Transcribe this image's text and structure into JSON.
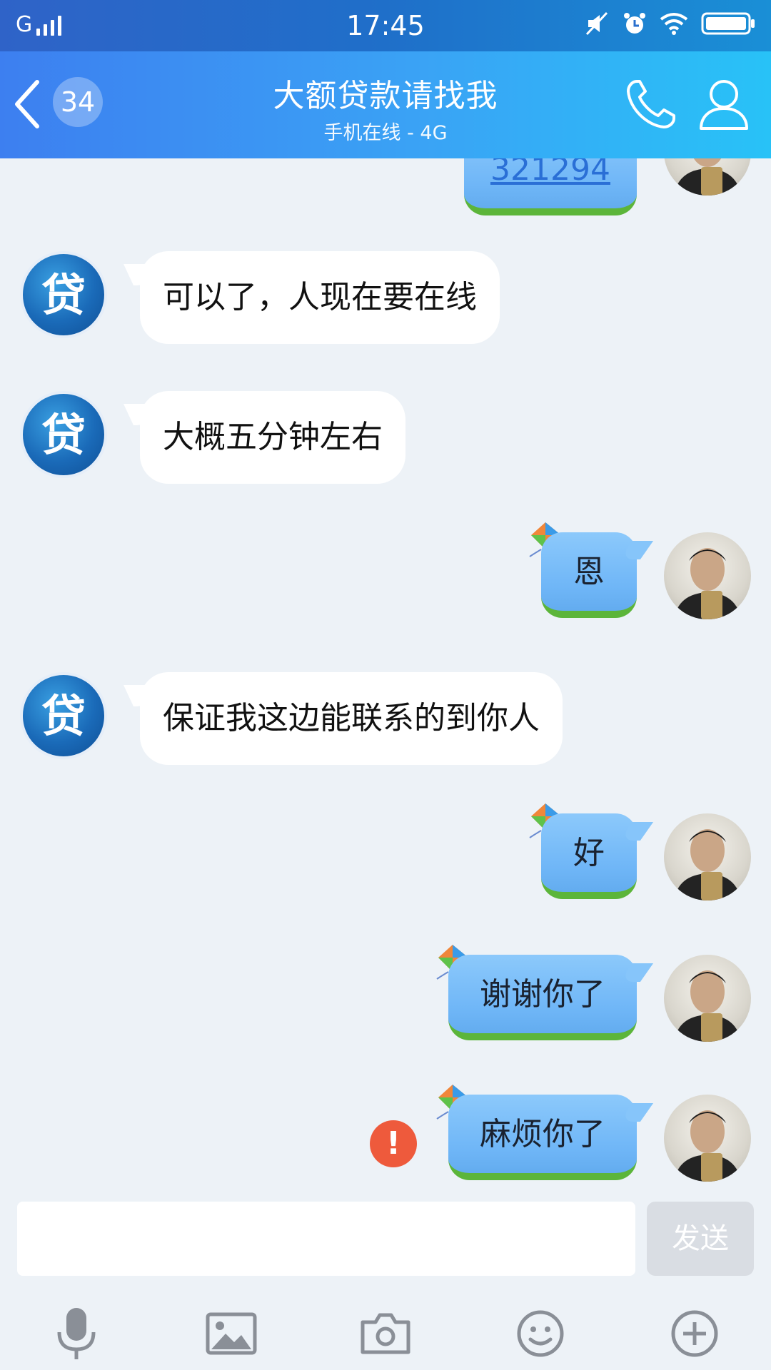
{
  "status_bar": {
    "network": "G",
    "time": "17:45"
  },
  "header": {
    "unread_count": "34",
    "title": "大额贷款请找我",
    "subtitle": "手机在线 - 4G"
  },
  "contact_avatar_glyph": "贷",
  "messages": [
    {
      "from": "me",
      "text": "321294"
    },
    {
      "from": "contact",
      "text": "可以了，人现在要在线"
    },
    {
      "from": "contact",
      "text": "大概五分钟左右"
    },
    {
      "from": "me",
      "text": "恩"
    },
    {
      "from": "contact",
      "text": "保证我这边能联系的到你人"
    },
    {
      "from": "me",
      "text": "好"
    },
    {
      "from": "me",
      "text": "谢谢你了"
    },
    {
      "from": "me",
      "text": "麻烦你了",
      "failed": true
    }
  ],
  "error_mark": "!",
  "input": {
    "value": "",
    "send_label": "发送"
  },
  "toolbar": [
    "microphone-icon",
    "image-icon",
    "camera-icon",
    "emoji-icon",
    "plus-icon"
  ],
  "colors": {
    "header_start": "#3d7ff0",
    "header_end": "#28c2f7",
    "chat_bg": "#edf2f7",
    "bubble_out": "#8cc9fb",
    "error": "#ee5a3c"
  }
}
